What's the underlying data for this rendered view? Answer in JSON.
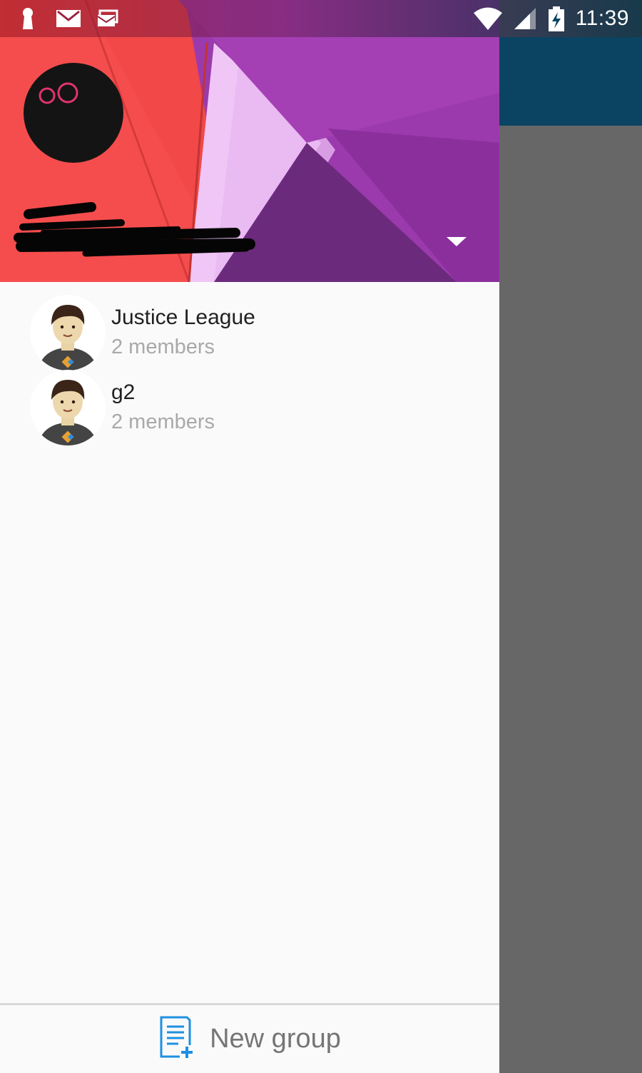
{
  "status_bar": {
    "time": "11:39",
    "left_icons": [
      "keyhole-icon",
      "gmail-icon",
      "email-icon"
    ],
    "right_icons": [
      "wifi-icon",
      "cell-signal-icon",
      "battery-charging-icon"
    ]
  },
  "drawer": {
    "header": {
      "avatar_logo": "oO",
      "account_name": "",
      "account_toggle_icon": "dropdown-arrow-icon"
    },
    "groups": [
      {
        "name": "Justice League",
        "subtitle": "2 members"
      },
      {
        "name": "g2",
        "subtitle": "2 members"
      }
    ],
    "footer": {
      "new_group_label": "New group",
      "new_group_icon": "new-group-icon"
    }
  },
  "colors": {
    "toolbar": "#0b4462",
    "scrim": "#666666",
    "drawer_bg": "#fafafa",
    "header_red": "#f24848",
    "header_purple": "#9b3aac",
    "avatar_logo": "#e0336f",
    "new_group_icon": "#1e90e0"
  }
}
